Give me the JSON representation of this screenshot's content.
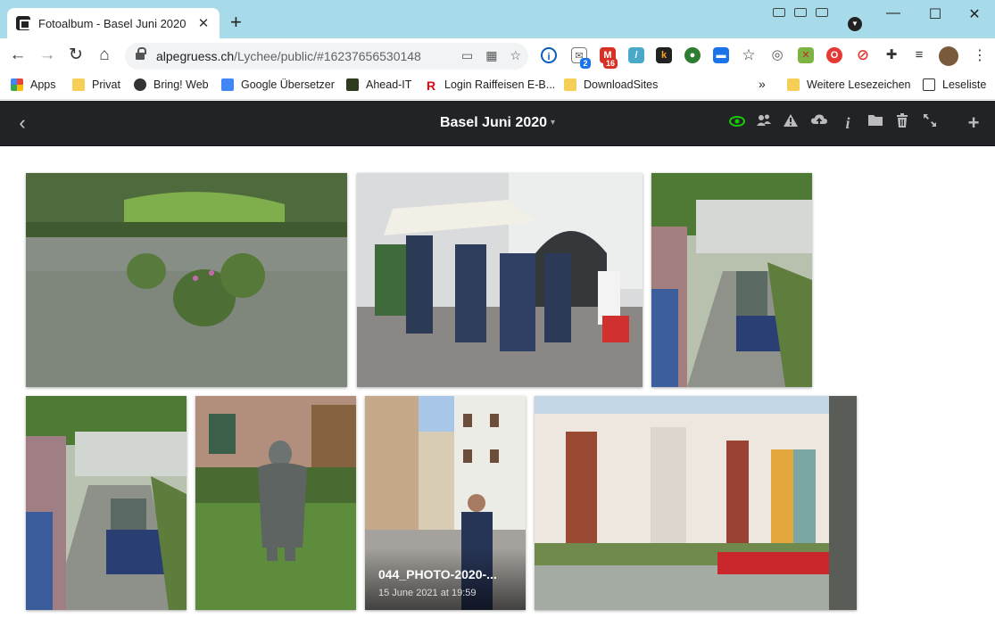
{
  "browser": {
    "tab_title": "Fotoalbum - Basel Juni 2020",
    "tab_close": "✕",
    "new_tab": "+",
    "url_host": "alpegruess.ch",
    "url_path": "/Lychee/public/#16237656530148",
    "bookmarks": [
      {
        "label": "Apps",
        "icon": "apps-grid-icon"
      },
      {
        "label": "Privat",
        "icon": "folder-icon"
      },
      {
        "label": "Bring! Web",
        "icon": "bring-icon"
      },
      {
        "label": "Google Übersetzer",
        "icon": "translate-icon"
      },
      {
        "label": "Ahead-IT",
        "icon": "ahead-icon"
      },
      {
        "label": "Login Raiffeisen E-B...",
        "icon": "raiffeisen-icon"
      },
      {
        "label": "DownloadSites",
        "icon": "folder-icon"
      }
    ],
    "bookmarks_more": "»",
    "other_bookmarks": "Weitere Lesezeichen",
    "reading_list": "Leseliste",
    "ext_badges": {
      "mail": "2",
      "gmail": "16"
    }
  },
  "header": {
    "album_title": "Basel Juni 2020",
    "caret": "▾",
    "back": "‹",
    "icons": [
      "eye-icon",
      "share-users-icon",
      "warning-icon",
      "upload-cloud-icon",
      "info-icon",
      "folder-move-icon",
      "trash-icon",
      "fullscreen-icon",
      "add-icon"
    ]
  },
  "photos": [
    {
      "id": "p1",
      "title": "",
      "date": ""
    },
    {
      "id": "p2",
      "title": "",
      "date": ""
    },
    {
      "id": "p3",
      "title": "",
      "date": ""
    },
    {
      "id": "p4",
      "title": "",
      "date": ""
    },
    {
      "id": "p5",
      "title": "",
      "date": ""
    },
    {
      "id": "p6",
      "title": "044_PHOTO-2020-...",
      "date": "15 June 2021 at 19:59"
    },
    {
      "id": "p7",
      "title": "",
      "date": ""
    }
  ]
}
